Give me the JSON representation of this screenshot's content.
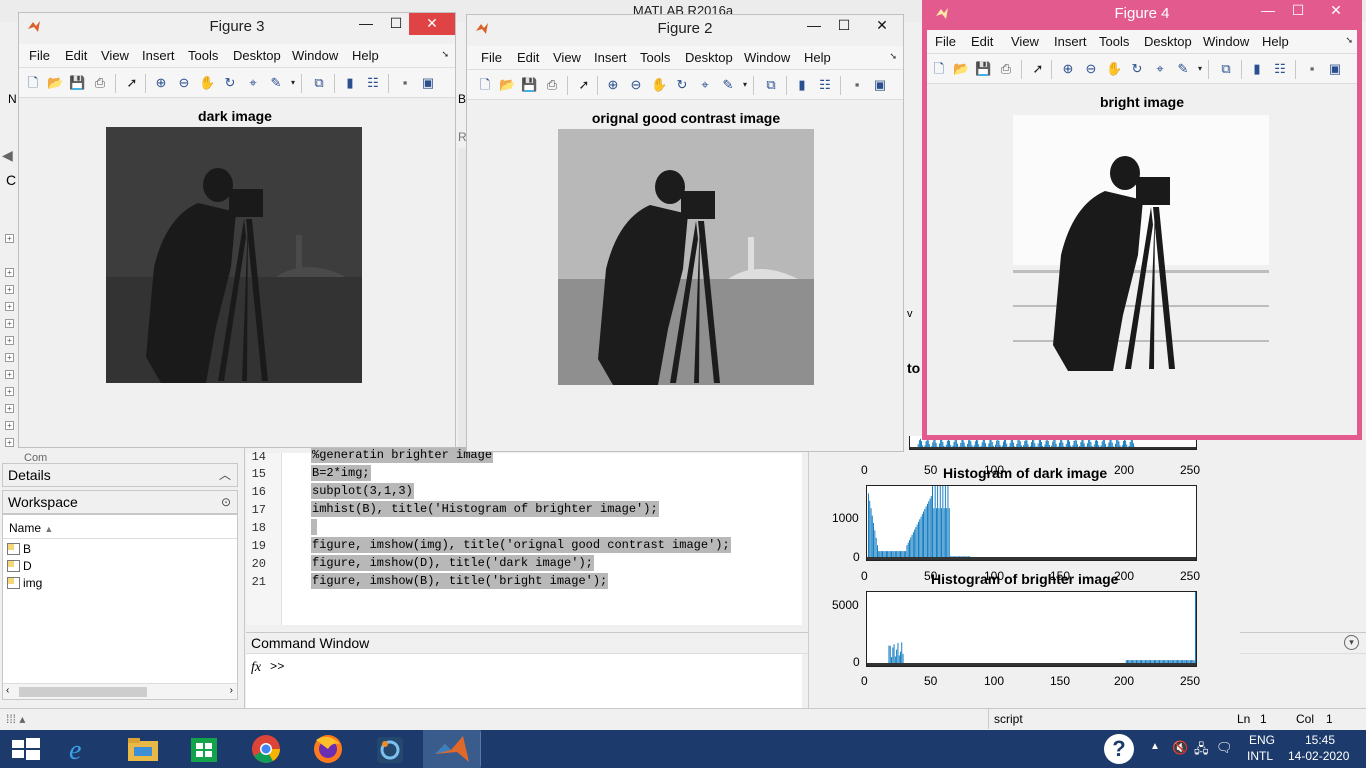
{
  "matlab": {
    "title": "MATLAB R2016a",
    "panels": {
      "details": "Details",
      "workspace": "Workspace",
      "name_col": "Name",
      "current_folder_item": "Com"
    },
    "workspace_vars": [
      "B",
      "D",
      "img"
    ],
    "editor_partial": [
      "%generatin brighter image"
    ],
    "editor_lines": [
      {
        "num": "14",
        "code": ""
      },
      {
        "num": "15",
        "code": "B=2*img;"
      },
      {
        "num": "16",
        "code": "subplot(3,1,3)"
      },
      {
        "num": "17",
        "code": "imhist(B), title('Histogram of brighter image');"
      },
      {
        "num": "18",
        "code": ""
      },
      {
        "num": "19",
        "code": "figure, imshow(img), title('orignal good contrast image');"
      },
      {
        "num": "20",
        "code": "figure, imshow(D), title('dark image');"
      },
      {
        "num": "21",
        "code": "figure, imshow(B), title('bright image');"
      }
    ],
    "command_window": {
      "title": "Command Window",
      "fx": "fx",
      "prompt": ">>"
    },
    "status": {
      "mode": "script",
      "ln_label": "Ln",
      "ln": "1",
      "col_label": "Col",
      "col": "1"
    },
    "peek_fragments": {
      "n": "N",
      "b": "B",
      "r": "R",
      "c": "C",
      "to": "to",
      "v": "v"
    }
  },
  "figures": {
    "menu": [
      "File",
      "Edit",
      "View",
      "Insert",
      "Tools",
      "Desktop",
      "Window",
      "Help"
    ],
    "fig3": {
      "title": "Figure 3",
      "axes_title": "dark image"
    },
    "fig2": {
      "title": "Figure 2",
      "axes_title": "orignal good contrast image"
    },
    "fig4": {
      "title": "Figure 4",
      "axes_title": "bright image",
      "accent": "#e35b8e"
    },
    "window_buttons": {
      "min": "—",
      "max": "☐",
      "close": "✕"
    }
  },
  "histogram_figure": {
    "top_xticks": [
      "0",
      "50",
      "100",
      "150",
      "200",
      "250"
    ],
    "plot2": {
      "title": "Histogram of dark image",
      "yticks": [
        "1000",
        "0"
      ],
      "xticks": [
        "0",
        "50",
        "100",
        "150",
        "200",
        "250"
      ]
    },
    "plot3": {
      "title": "Histogram of brighter image",
      "yticks": [
        "5000",
        "0"
      ],
      "xticks": [
        "0",
        "50",
        "100",
        "150",
        "200",
        "250"
      ]
    },
    "bar_color": "#0072bd"
  },
  "taskbar": {
    "apps": [
      "start-icon",
      "internet-explorer-icon",
      "file-explorer-icon",
      "store-icon",
      "chrome-icon",
      "firefox-icon",
      "control-app-icon",
      "matlab-icon"
    ],
    "lang1": "ENG",
    "lang2": "INTL",
    "time": "15:45",
    "date": "14-02-2020",
    "help": "?"
  }
}
